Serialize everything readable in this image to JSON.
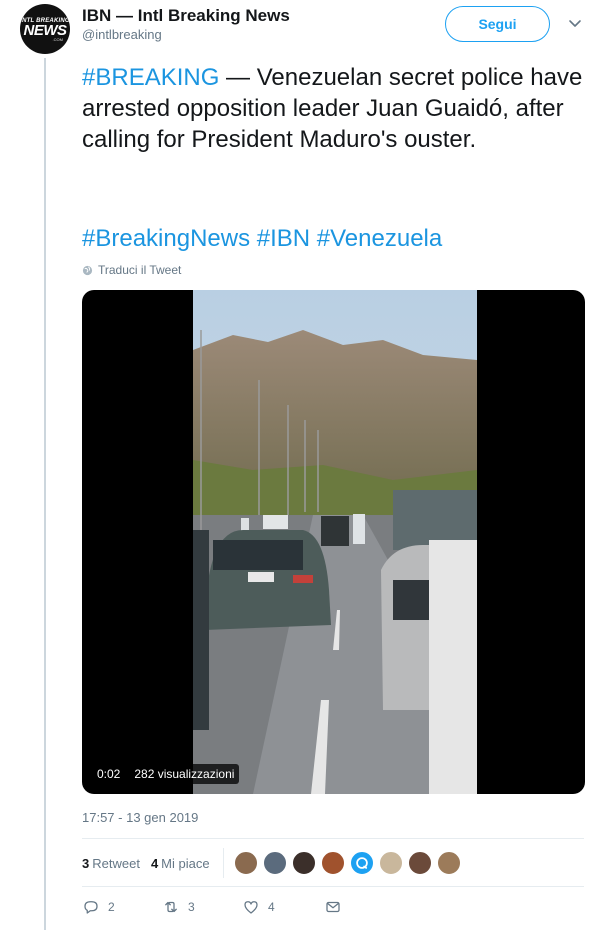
{
  "account": {
    "display_name": "IBN — Intl Breaking News",
    "handle": "@intlbreaking",
    "avatar_text_small": "INTL BREAKING",
    "avatar_text_big": "NEWS",
    "avatar_text_tiny": ".COM"
  },
  "follow_label": "Segui",
  "tweet": {
    "hashtag_lead": "#BREAKING",
    "body": " — Venezuelan secret police have arrested opposition leader Juan Guaidó, after calling for President Maduro's ouster.",
    "tags": "#BreakingNews #IBN #Venezuela",
    "translate_label": "Traduci il Tweet"
  },
  "video": {
    "duration": "0:02",
    "views": "282 visualizzazioni"
  },
  "timestamp": "17:57 - 13 gen 2019",
  "stats": {
    "retweets_count": "3",
    "retweets_label": "Retweet",
    "likes_count": "4",
    "likes_label": "Mi piace"
  },
  "actions": {
    "reply_count": "2",
    "retweet_count": "3",
    "like_count": "4"
  },
  "colors": {
    "accent": "#1da1f2",
    "hashtag": "#1b95e0",
    "secondary_text": "#657786",
    "liker_avatars": [
      "#8a6a4f",
      "#5b6b7d",
      "#3b2f2a",
      "#a0522d",
      "#1da1f2",
      "#c9b79c",
      "#6b4a3a",
      "#9c7b5a"
    ]
  }
}
